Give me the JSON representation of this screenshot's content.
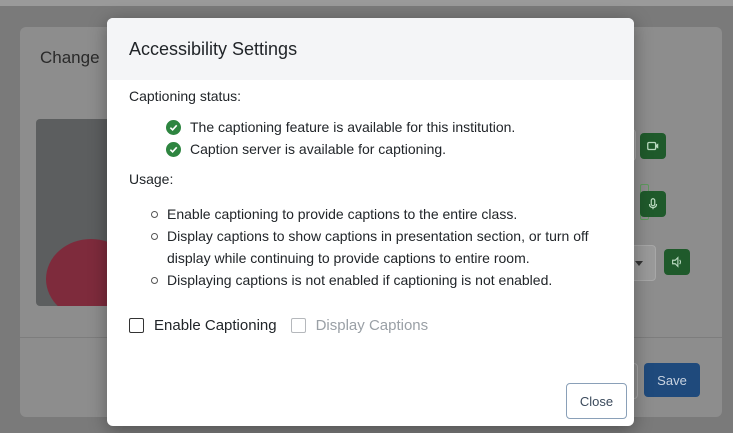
{
  "background": {
    "modal_title": "Change",
    "save_label": "Save"
  },
  "dialog": {
    "title": "Accessibility Settings",
    "captioning_status_label": "Captioning status:",
    "status_items": [
      "The captioning feature is available for this institution.",
      "Caption server is available for captioning."
    ],
    "usage_label": "Usage:",
    "usage_items": [
      "Enable captioning to provide captions to the entire class.",
      "Display captions to show captions in presentation section, or turn off display while continuing to provide captions to entire room.",
      "Displaying captions is not enabled if captioning is not enabled."
    ],
    "enable_captioning_label": "Enable Captioning",
    "display_captions_label": "Display Captions",
    "close_label": "Close"
  },
  "colors": {
    "check_green": "#2e8540",
    "overlay": "#7a7a7a",
    "save_blue": "#1f4a7c"
  }
}
